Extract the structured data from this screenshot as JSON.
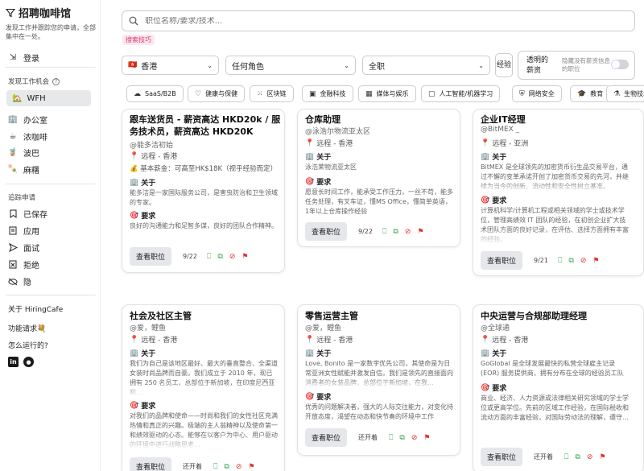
{
  "sidebar": {
    "brand": "招聘咖啡馆",
    "tagline": "发现工作并跟踪您的申请，全部集中在一处。",
    "login": "登录",
    "discover_heading": "发现工作机会",
    "items": [
      {
        "label": "WFH",
        "icon": "house-icon"
      },
      {
        "label": "办公室",
        "icon": "office-icon"
      },
      {
        "label": "浓咖啡",
        "icon": "coffee-icon"
      },
      {
        "label": "波巴",
        "icon": "boba-icon"
      },
      {
        "label": "麻糬",
        "icon": "mochi-icon"
      }
    ],
    "tracking_heading": "追踪申请",
    "tracking": [
      {
        "label": "已保存",
        "icon": "bookmark-icon"
      },
      {
        "label": "应用",
        "icon": "document-icon"
      },
      {
        "label": "面试",
        "icon": "send-icon"
      },
      {
        "label": "拒绝",
        "icon": "document-x-icon"
      },
      {
        "label": "隐",
        "icon": "eye-off-icon"
      }
    ],
    "about": "关于 HiringCafe",
    "feature_request": "功能请求💐",
    "how_it_works": "怎么运行的?"
  },
  "search": {
    "placeholder": "职位名称/要求/技术...",
    "tip": "搜索技巧"
  },
  "filters": {
    "location": "香港",
    "role": "任何角色",
    "type": "全职",
    "experience": "经验",
    "transparent_label": "透明的薪资",
    "hide_label": "隐藏没有薪资信息的职位"
  },
  "chips": [
    {
      "label": "SaaS/B2B",
      "icon": "cloud-icon"
    },
    {
      "label": "健康与保健",
      "icon": "heart-icon"
    },
    {
      "label": "区块链",
      "icon": "blockchain-icon"
    },
    {
      "label": "金融科技",
      "icon": "fintech-icon"
    },
    {
      "label": "媒体与娱乐",
      "icon": "film-icon"
    },
    {
      "label": "人工智能/机器学习",
      "icon": "ai-icon"
    },
    {
      "label": "网络安全",
      "icon": "shield-icon"
    },
    {
      "label": "教育",
      "icon": "graduation-icon"
    },
    {
      "label": "生物技术",
      "icon": "biotech-icon"
    }
  ],
  "common": {
    "about": "关于",
    "requirements": "要求",
    "view": "查看职位",
    "base_salary": "基本薪金："
  },
  "cards": [
    {
      "title": "跟车送货员 - 薪资高达 HKD20k / 服务技术员，薪资高达 HKD20K",
      "company": "@能多洁初始",
      "location": "远程 - 香港",
      "salary": "可高至HK$18K（视乎经验而定）",
      "about": "能多洁是一家国际服务公司，是害虫防治和卫生领域的专家。",
      "requirements": "良好的沟通能力和足智多谋，良好的团队合作精神。",
      "date": "9/22"
    },
    {
      "title": "仓库助理",
      "company": "@泳浩尔物流亚太区",
      "location": "远程 - 香港",
      "about": "泳浩莱物流亚太区",
      "requirements": "愿意长时间工作，能承受工作压力，一丝不苟，能多任务处理，有叉车证，懂MS Office，懂简单英语，1年以上仓库操作经验",
      "date": "9/22"
    },
    {
      "title": "企业IT经理",
      "company": "@BitMEX _",
      "location": "远程 - 亚洲",
      "about": "BitMEX 是全球领先的加密货币衍生品交易平台，通过不懈的变革承诺开创了加密货币交易的先河，并继续为当今的创新、流动性和安全性树立基准。",
      "requirements": "计算机科学/计算机工程或相关领域的学士或技术学位，管理高绩效 IT 团队的经验，在初创企业扩大技术团队方面的良好记录，在评估、选择方面拥有丰富的经验。",
      "date": "9/21"
    },
    {
      "title": "社会及社区主管",
      "company": "@爱，鲤鱼",
      "location": "远程 - 香港",
      "about": "我们为自己是该地区最好、最大的垂直整合、全渠道女装时尚品牌而自豪。我们成立于 2010 年，现已拥有 250 名员工，总部位于新加坡，在印度尼西亚和...",
      "requirements": "对我们的品牌和使命——时尚和我们的女性社区充满热情和真正的兴趣。极端的主人翁精神以及使命第一和绩效驱动的心态。能够在以客户为中心、用户驱动的环境中进行战略思考...",
      "status": "还开着"
    },
    {
      "title": "零售运营主管",
      "company": "@爱，鲤鱼",
      "location": "远程 - 香港",
      "about": "Love, Bonito 是一家数字优先公司，其使命是为日常亚洲女性赋能并激发自信。我们是领先的直接面向消费者的女装品牌，总部位于新加坡，在我...",
      "requirements": "优秀的问题解决者，强大的人际交往能力，对变化持开放态度，渴望在动态和快节奏的环境中工作",
      "status": "还开着"
    },
    {
      "title": "中央运营与合规部助理经理",
      "company": "@全球通",
      "location": "远程 - 香港",
      "about": "GoGlobal 是全球发展最快的私营全球雇主记录(EOR) 服务提供商，拥有分布在全球的经验员工队伍。",
      "requirements": "商业、经济、人力资源或法律相关研究领域的学士学位或更高学位。先前的区域工作经验，在国际税收和流动方面的丰富经验，对国际劳动法的理解，遵守...",
      "status": "还开着"
    }
  ]
}
